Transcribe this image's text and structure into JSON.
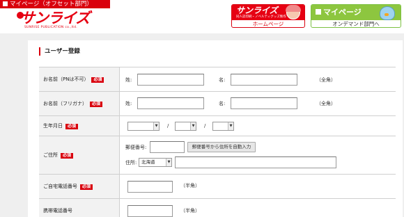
{
  "header": {
    "top_tab_label": "マイページ（オフセット部門）",
    "logo_main": "サンライズ",
    "logo_sub": "SUNRISE PUBLICATION co.,ltd.",
    "home_banner": "サンライズ",
    "home_banner_sub": "同人誌印刷・ノベルティグッズ製作",
    "home_label": "ホームページ",
    "od_banner": "マイページ",
    "od_label": "オンデマンド部門へ"
  },
  "form": {
    "title": "ユーザー登録",
    "required_badge": "必須",
    "name": {
      "label": "お名前（PNは不可）",
      "sei": "姓:",
      "mei": "名:",
      "note": "（全角）",
      "sei_value": "",
      "mei_value": ""
    },
    "kana": {
      "label": "お名前（フリガナ）",
      "sei": "姓:",
      "mei": "名:",
      "note": "（全角）",
      "sei_value": "",
      "mei_value": ""
    },
    "birth": {
      "label": "生年月日",
      "sep1": "/",
      "sep2": "/",
      "year": "",
      "month": "",
      "day": ""
    },
    "address": {
      "label": "ご住所",
      "postal_label": "郵便番号:",
      "postal_value": "",
      "autofill_button": "郵便番号から住所を自動入力",
      "address_label": "住所:",
      "prefecture": "北海道",
      "address_value": ""
    },
    "home_phone": {
      "label": "ご自宅電話番号",
      "note": "（半角）",
      "value": ""
    },
    "mobile_phone": {
      "label": "携帯電話番号",
      "note": "（半角）",
      "value": ""
    }
  }
}
